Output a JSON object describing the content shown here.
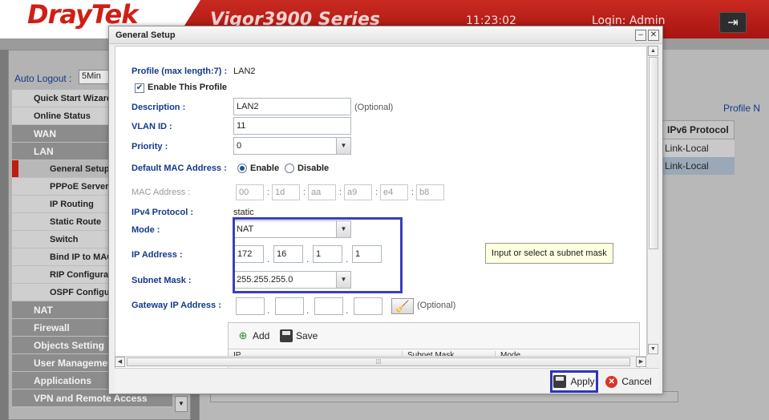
{
  "app": {
    "logo": "DrayTek",
    "model": "Vigor3900 Series",
    "clock": "11:23:02",
    "login": "Login: Admin",
    "logout_icon": "logout-icon"
  },
  "sidebar": {
    "auto_logout_label": "Auto Logout :",
    "auto_logout_value": "5Min",
    "items": [
      {
        "label": "Quick Start Wizard"
      },
      {
        "label": "Online Status"
      },
      {
        "label": "WAN"
      },
      {
        "label": "LAN"
      },
      {
        "label": "General Setup"
      },
      {
        "label": "PPPoE Server"
      },
      {
        "label": "IP Routing"
      },
      {
        "label": "Static Route"
      },
      {
        "label": "Switch"
      },
      {
        "label": "Bind IP to MAC"
      },
      {
        "label": "RIP Configuration"
      },
      {
        "label": "OSPF Configuration"
      },
      {
        "label": "NAT"
      },
      {
        "label": "Firewall"
      },
      {
        "label": "Objects Setting"
      },
      {
        "label": "User Management"
      },
      {
        "label": "Applications"
      },
      {
        "label": "VPN and Remote Access"
      }
    ]
  },
  "background_table": {
    "profile_link": "Profile N",
    "column_header": "IPv6 Protocol",
    "rows": [
      "Link-Local",
      "Link-Local"
    ]
  },
  "dialog": {
    "title": "General Setup",
    "minimize_label": "–",
    "close_label": "✕",
    "form": {
      "profile_label": "Profile (max length:7) :",
      "profile_value": "LAN2",
      "enable_profile_label": "Enable This Profile",
      "description_label": "Description :",
      "description_value": "LAN2",
      "description_hint": "(Optional)",
      "vlan_label": "VLAN ID :",
      "vlan_value": "11",
      "priority_label": "Priority :",
      "priority_value": "0",
      "default_mac_label": "Default MAC Address :",
      "enable_label": "Enable",
      "disable_label": "Disable",
      "mac_label": "MAC Address :",
      "mac_octets": [
        "00",
        "1d",
        "aa",
        "a9",
        "e4",
        "b8"
      ],
      "ipv4_label": "IPv4 Protocol :",
      "ipv4_value": "static",
      "mode_label": "Mode :",
      "mode_value": "NAT",
      "ip_label": "IP Address :",
      "ip_octets": [
        "172",
        "16",
        "1",
        "1"
      ],
      "subnet_label": "Subnet Mask :",
      "subnet_value": "255.255.255.0",
      "gateway_label": "Gateway IP Address :",
      "gateway_octets": [
        "",
        "",
        "",
        ""
      ],
      "gateway_hint": "(Optional)",
      "tooltip": "Input or select a subnet mask"
    },
    "grid": {
      "add_label": "Add",
      "save_label": "Save",
      "columns": [
        "IP",
        "Subnet Mask",
        "Mode"
      ]
    },
    "buttons": {
      "apply": "Apply",
      "cancel": "Cancel"
    }
  },
  "colors": {
    "brand_red": "#c92a22",
    "label_blue": "#123a8a",
    "highlight": "#3a3fbd"
  }
}
